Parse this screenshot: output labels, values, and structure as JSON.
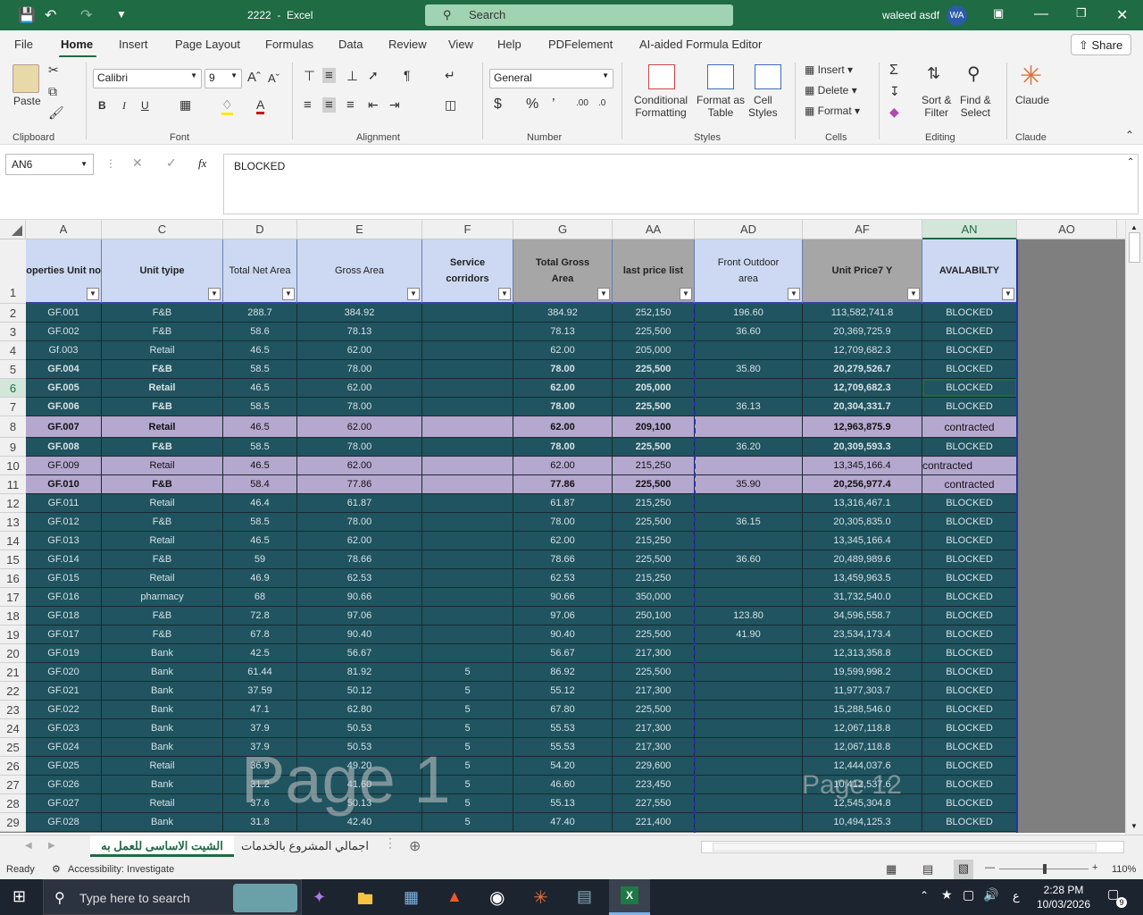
{
  "titlebar": {
    "filename": "2222",
    "separator": "-",
    "app": "Excel",
    "search_placeholder": "Search",
    "user": "waleed asdf",
    "user_initials": "WA"
  },
  "menu": [
    "File",
    "Home",
    "Insert",
    "Page Layout",
    "Formulas",
    "Data",
    "Review",
    "View",
    "Help",
    "PDFelement",
    "AI-aided Formula Editor"
  ],
  "share_label": "Share",
  "ribbon": {
    "clipboard": {
      "paste": "Paste",
      "group": "Clipboard"
    },
    "font": {
      "name": "Calibri",
      "size": "9",
      "group": "Font",
      "bold": "B",
      "italic": "I",
      "underline": "U"
    },
    "alignment": {
      "group": "Alignment"
    },
    "number": {
      "format": "General",
      "group": "Number"
    },
    "styles": {
      "conditional": [
        "Conditional",
        "Formatting"
      ],
      "format_as": [
        "Format as",
        "Table"
      ],
      "cell_styles": [
        "Cell",
        "Styles"
      ],
      "group": "Styles"
    },
    "cells": {
      "insert": "Insert",
      "delete": "Delete",
      "format": "Format",
      "group": "Cells"
    },
    "editing": {
      "sort": [
        "Sort &",
        "Filter"
      ],
      "find": [
        "Find &",
        "Select"
      ],
      "group": "Editing"
    },
    "claude": {
      "label": "Claude",
      "group": "Claude"
    }
  },
  "formula_bar": {
    "name_box": "AN6",
    "fx": "fx",
    "content": "BLOCKED"
  },
  "columns": [
    "A",
    "C",
    "D",
    "E",
    "F",
    "G",
    "AA",
    "AD",
    "AF",
    "AN",
    "AO"
  ],
  "headers": [
    "operties Unit no",
    "Unit tyipe",
    "Total Net Area",
    "Gross Area",
    "Service corridors",
    "Total Gross Area",
    "last price list",
    "Front Outdoor area",
    "Unit Price7 Y",
    "AVALABILTY"
  ],
  "rows": [
    {
      "n": "2",
      "a": "GF.001",
      "c": "F&B",
      "d": "288.7",
      "e": "384.92",
      "f": "",
      "g": "384.92",
      "aa": "252,150",
      "ad": "196.60",
      "af": "113,582,741.8",
      "an": "BLOCKED",
      "style": "teal"
    },
    {
      "n": "3",
      "a": "GF.002",
      "c": "F&B",
      "d": "58.6",
      "e": "78.13",
      "f": "",
      "g": "78.13",
      "aa": "225,500",
      "ad": "36.60",
      "af": "20,369,725.9",
      "an": "BLOCKED",
      "style": "teal"
    },
    {
      "n": "4",
      "a": "Gf.003",
      "c": "Retail",
      "d": "46.5",
      "e": "62.00",
      "f": "",
      "g": "62.00",
      "aa": "205,000",
      "ad": "",
      "af": "12,709,682.3",
      "an": "BLOCKED",
      "style": "teal"
    },
    {
      "n": "5",
      "a": "GF.004",
      "c": "F&B",
      "d": "58.5",
      "e": "78.00",
      "f": "",
      "g": "78.00",
      "aa": "225,500",
      "ad": "35.80",
      "af": "20,279,526.7",
      "an": "BLOCKED",
      "style": "teal",
      "bold": true
    },
    {
      "n": "6",
      "a": "GF.005",
      "c": "Retail",
      "d": "46.5",
      "e": "62.00",
      "f": "",
      "g": "62.00",
      "aa": "205,000",
      "ad": "",
      "af": "12,709,682.3",
      "an": "BLOCKED",
      "style": "teal",
      "bold": true
    },
    {
      "n": "7",
      "a": "GF.006",
      "c": "F&B",
      "d": "58.5",
      "e": "78.00",
      "f": "",
      "g": "78.00",
      "aa": "225,500",
      "ad": "36.13",
      "af": "20,304,331.7",
      "an": "BLOCKED",
      "style": "teal",
      "bold": true
    },
    {
      "n": "8",
      "a": "GF.007",
      "c": "Retail",
      "d": "46.5",
      "e": "62.00",
      "f": "",
      "g": "62.00",
      "aa": "209,100",
      "ad": "",
      "af": "12,963,875.9",
      "an": "contracted",
      "style": "purple",
      "bold": true
    },
    {
      "n": "9",
      "a": "GF.008",
      "c": "F&B",
      "d": "58.5",
      "e": "78.00",
      "f": "",
      "g": "78.00",
      "aa": "225,500",
      "ad": "36.20",
      "af": "20,309,593.3",
      "an": "BLOCKED",
      "style": "teal",
      "bold": true
    },
    {
      "n": "10",
      "a": "GF.009",
      "c": "Retail",
      "d": "46.5",
      "e": "62.00",
      "f": "",
      "g": "62.00",
      "aa": "215,250",
      "ad": "",
      "af": "13,345,166.4",
      "an": "contracted",
      "style": "purple",
      "anleft": true
    },
    {
      "n": "11",
      "a": "GF.010",
      "c": "F&B",
      "d": "58.4",
      "e": "77.86",
      "f": "",
      "g": "77.86",
      "aa": "225,500",
      "ad": "35.90",
      "af": "20,256,977.4",
      "an": "contracted",
      "style": "purple",
      "bold": true
    },
    {
      "n": "12",
      "a": "GF.011",
      "c": "Retail",
      "d": "46.4",
      "e": "61.87",
      "f": "",
      "g": "61.87",
      "aa": "215,250",
      "ad": "",
      "af": "13,316,467.1",
      "an": "BLOCKED",
      "style": "teal"
    },
    {
      "n": "13",
      "a": "GF.012",
      "c": "F&B",
      "d": "58.5",
      "e": "78.00",
      "f": "",
      "g": "78.00",
      "aa": "225,500",
      "ad": "36.15",
      "af": "20,305,835.0",
      "an": "BLOCKED",
      "style": "teal"
    },
    {
      "n": "14",
      "a": "GF.013",
      "c": "Retail",
      "d": "46.5",
      "e": "62.00",
      "f": "",
      "g": "62.00",
      "aa": "215,250",
      "ad": "",
      "af": "13,345,166.4",
      "an": "BLOCKED",
      "style": "teal"
    },
    {
      "n": "15",
      "a": "GF.014",
      "c": "F&B",
      "d": "59",
      "e": "78.66",
      "f": "",
      "g": "78.66",
      "aa": "225,500",
      "ad": "36.60",
      "af": "20,489,989.6",
      "an": "BLOCKED",
      "style": "teal"
    },
    {
      "n": "16",
      "a": "GF.015",
      "c": "Retail",
      "d": "46.9",
      "e": "62.53",
      "f": "",
      "g": "62.53",
      "aa": "215,250",
      "ad": "",
      "af": "13,459,963.5",
      "an": "BLOCKED",
      "style": "teal"
    },
    {
      "n": "17",
      "a": "GF.016",
      "c": "pharmacy",
      "d": "68",
      "e": "90.66",
      "f": "",
      "g": "90.66",
      "aa": "350,000",
      "ad": "",
      "af": "31,732,540.0",
      "an": "BLOCKED",
      "style": "teal"
    },
    {
      "n": "18",
      "a": "GF.018",
      "c": "F&B",
      "d": "72.8",
      "e": "97.06",
      "f": "",
      "g": "97.06",
      "aa": "250,100",
      "ad": "123.80",
      "af": "34,596,558.7",
      "an": "BLOCKED",
      "style": "teal"
    },
    {
      "n": "19",
      "a": "GF.017",
      "c": "F&B",
      "d": "67.8",
      "e": "90.40",
      "f": "",
      "g": "90.40",
      "aa": "225,500",
      "ad": "41.90",
      "af": "23,534,173.4",
      "an": "BLOCKED",
      "style": "teal"
    },
    {
      "n": "20",
      "a": "GF.019",
      "c": "Bank",
      "d": "42.5",
      "e": "56.67",
      "f": "",
      "g": "56.67",
      "aa": "217,300",
      "ad": "",
      "af": "12,313,358.8",
      "an": "BLOCKED",
      "style": "teal"
    },
    {
      "n": "21",
      "a": "GF.020",
      "c": "Bank",
      "d": "61.44",
      "e": "81.92",
      "f": "5",
      "g": "86.92",
      "aa": "225,500",
      "ad": "",
      "af": "19,599,998.2",
      "an": "BLOCKED",
      "style": "teal"
    },
    {
      "n": "22",
      "a": "GF.021",
      "c": "Bank",
      "d": "37.59",
      "e": "50.12",
      "f": "5",
      "g": "55.12",
      "aa": "217,300",
      "ad": "",
      "af": "11,977,303.7",
      "an": "BLOCKED",
      "style": "teal"
    },
    {
      "n": "23",
      "a": "GF.022",
      "c": "Bank",
      "d": "47.1",
      "e": "62.80",
      "f": "5",
      "g": "67.80",
      "aa": "225,500",
      "ad": "",
      "af": "15,288,546.0",
      "an": "BLOCKED",
      "style": "teal"
    },
    {
      "n": "24",
      "a": "GF.023",
      "c": "Bank",
      "d": "37.9",
      "e": "50.53",
      "f": "5",
      "g": "55.53",
      "aa": "217,300",
      "ad": "",
      "af": "12,067,118.8",
      "an": "BLOCKED",
      "style": "teal"
    },
    {
      "n": "25",
      "a": "GF.024",
      "c": "Bank",
      "d": "37.9",
      "e": "50.53",
      "f": "5",
      "g": "55.53",
      "aa": "217,300",
      "ad": "",
      "af": "12,067,118.8",
      "an": "BLOCKED",
      "style": "teal"
    },
    {
      "n": "26",
      "a": "GF.025",
      "c": "Retail",
      "d": "36.9",
      "e": "49.20",
      "f": "5",
      "g": "54.20",
      "aa": "229,600",
      "ad": "",
      "af": "12,444,037.6",
      "an": "BLOCKED",
      "style": "teal"
    },
    {
      "n": "27",
      "a": "GF.026",
      "c": "Bank",
      "d": "31.2",
      "e": "41.60",
      "f": "5",
      "g": "46.60",
      "aa": "223,450",
      "ad": "",
      "af": "10,412,537.6",
      "an": "BLOCKED",
      "style": "teal"
    },
    {
      "n": "28",
      "a": "GF.027",
      "c": "Retail",
      "d": "37.6",
      "e": "50.13",
      "f": "5",
      "g": "55.13",
      "aa": "227,550",
      "ad": "",
      "af": "12,545,304.8",
      "an": "BLOCKED",
      "style": "teal"
    },
    {
      "n": "29",
      "a": "GF.028",
      "c": "Bank",
      "d": "31.8",
      "e": "42.40",
      "f": "5",
      "g": "47.40",
      "aa": "221,400",
      "ad": "",
      "af": "10,494,125.3",
      "an": "BLOCKED",
      "style": "teal"
    }
  ],
  "watermarks": {
    "page1": "Page 1",
    "page12": "Page 12"
  },
  "sheets": [
    "الشيت الاساسى للعمل به",
    "اجمالي المشروع بالخدمات"
  ],
  "status": {
    "ready": "Ready",
    "accessibility": "Accessibility: Investigate",
    "zoom": "110%"
  },
  "taskbar": {
    "search_placeholder": "Type here to search",
    "time": "2:28 PM",
    "date": "10/03/2026",
    "lang": "ع",
    "notif_count": "9"
  }
}
